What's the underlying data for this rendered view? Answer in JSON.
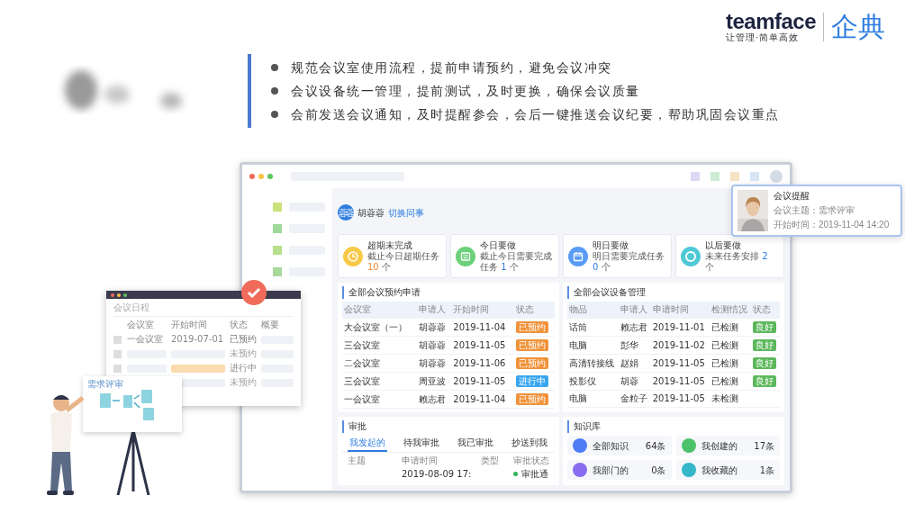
{
  "logo": {
    "brand": "teamface",
    "tagline": "让管理·简单高效",
    "product": "企典"
  },
  "bullets": [
    "规范会议室使用流程，提前申请预约，避免会议冲突",
    "会议设备统一管理，提前测试，及时更换，确保会议质量",
    "会前发送会议通知，及时提醒参会，会后一键推送会议纪要，帮助巩固会议重点"
  ],
  "app": {
    "user": {
      "avatar_text": "蓉蓉",
      "name": "胡蓉蓉",
      "switch_link": "切换同事"
    },
    "task_cards": [
      {
        "title": "超期未完成",
        "desc": "截止今日超期任务",
        "count": "10",
        "unit": "个",
        "overdue": true,
        "color": "#f7c948"
      },
      {
        "title": "今日要做",
        "desc": "截止今日需要完成任务",
        "count": "1",
        "unit": "个",
        "overdue": false,
        "color": "#6bd07a"
      },
      {
        "title": "明日要做",
        "desc": "明日需要完成任务",
        "count": "0",
        "unit": "个",
        "overdue": false,
        "color": "#5a9cf5"
      },
      {
        "title": "以后要做",
        "desc": "未来任务安排",
        "count": "2",
        "unit": "个",
        "overdue": false,
        "color": "#4fc9d6"
      }
    ],
    "bookings": {
      "title": "全部会议预约申请",
      "columns": [
        "会议室",
        "申请人",
        "开始时间",
        "状态"
      ],
      "rows": [
        {
          "cells": [
            "大会议室（一）",
            "胡蓉蓉",
            "2019-11-04"
          ],
          "status": "已预约",
          "kind": "reserved"
        },
        {
          "cells": [
            "三会议室",
            "胡蓉蓉",
            "2019-11-05"
          ],
          "status": "已预约",
          "kind": "reserved"
        },
        {
          "cells": [
            "二会议室",
            "胡蓉蓉",
            "2019-11-06"
          ],
          "status": "已预约",
          "kind": "reserved"
        },
        {
          "cells": [
            "三会议室",
            "周亚波",
            "2019-11-05"
          ],
          "status": "进行中",
          "kind": "ongoing"
        },
        {
          "cells": [
            "一会议室",
            "赖志君",
            "2019-11-04"
          ],
          "status": "已预约",
          "kind": "reserved"
        }
      ]
    },
    "equipment": {
      "title": "全部会议设备管理",
      "columns": [
        "物品",
        "申请人",
        "申请时间",
        "检测情况",
        "状态"
      ],
      "rows": [
        {
          "cells": [
            "话筒",
            "赖志君",
            "2019-11-01",
            "已检测"
          ],
          "status": "良好"
        },
        {
          "cells": [
            "电脑",
            "彭华",
            "2019-11-02",
            "已检测"
          ],
          "status": "良好"
        },
        {
          "cells": [
            "高清转接线",
            "赵娟",
            "2019-11-05",
            "已检测"
          ],
          "status": "良好"
        },
        {
          "cells": [
            "投影仪",
            "胡蓉",
            "2019-11-05",
            "已检测"
          ],
          "status": "良好"
        },
        {
          "cells": [
            "电脑",
            "金粒子",
            "2019-11-05",
            "未检测"
          ]
        }
      ]
    },
    "approval": {
      "title": "审批",
      "tabs": [
        {
          "label": "我发起的",
          "selected": true
        },
        {
          "label": "待我审批",
          "selected": false
        },
        {
          "label": "我已审批",
          "selected": false
        },
        {
          "label": "抄送到我",
          "selected": false
        }
      ],
      "columns": [
        "主题",
        "申请时间",
        "类型",
        "审批状态"
      ],
      "rows": [
        {
          "time": "2019-08-09 17:",
          "status": "审批通",
          "color": "#2fb35a"
        }
      ]
    },
    "knowledge": {
      "title": "知识库",
      "items": [
        {
          "label": "全部知识",
          "count": "64条",
          "color": "#4f7cf7"
        },
        {
          "label": "我创建的",
          "count": "17条",
          "color": "#4cc26b"
        },
        {
          "label": "我部门的",
          "count": "0条",
          "color": "#8a6cf0"
        },
        {
          "label": "我收藏的",
          "count": "1条",
          "color": "#35b6c9"
        }
      ]
    },
    "notification": {
      "title": "会议提醒",
      "lines": [
        "会议主题：需求评审",
        "开始时间：2019-11-04 14:20"
      ]
    }
  },
  "schedule_window": {
    "title": "会议日程",
    "columns": [
      "会议室",
      "开始时间",
      "状态",
      "概要"
    ],
    "rows": [
      {
        "room": "一会议室",
        "time": "2019-07-01",
        "status": "已预约",
        "kind": "reserved",
        "checked": false
      },
      {
        "status": "未预约",
        "kind": "free",
        "checked": false
      },
      {
        "status": "进行中",
        "kind": "ongoing",
        "checked": false
      },
      {
        "status": "未预约",
        "kind": "free"
      }
    ]
  },
  "board": {
    "title": "需求评审"
  }
}
